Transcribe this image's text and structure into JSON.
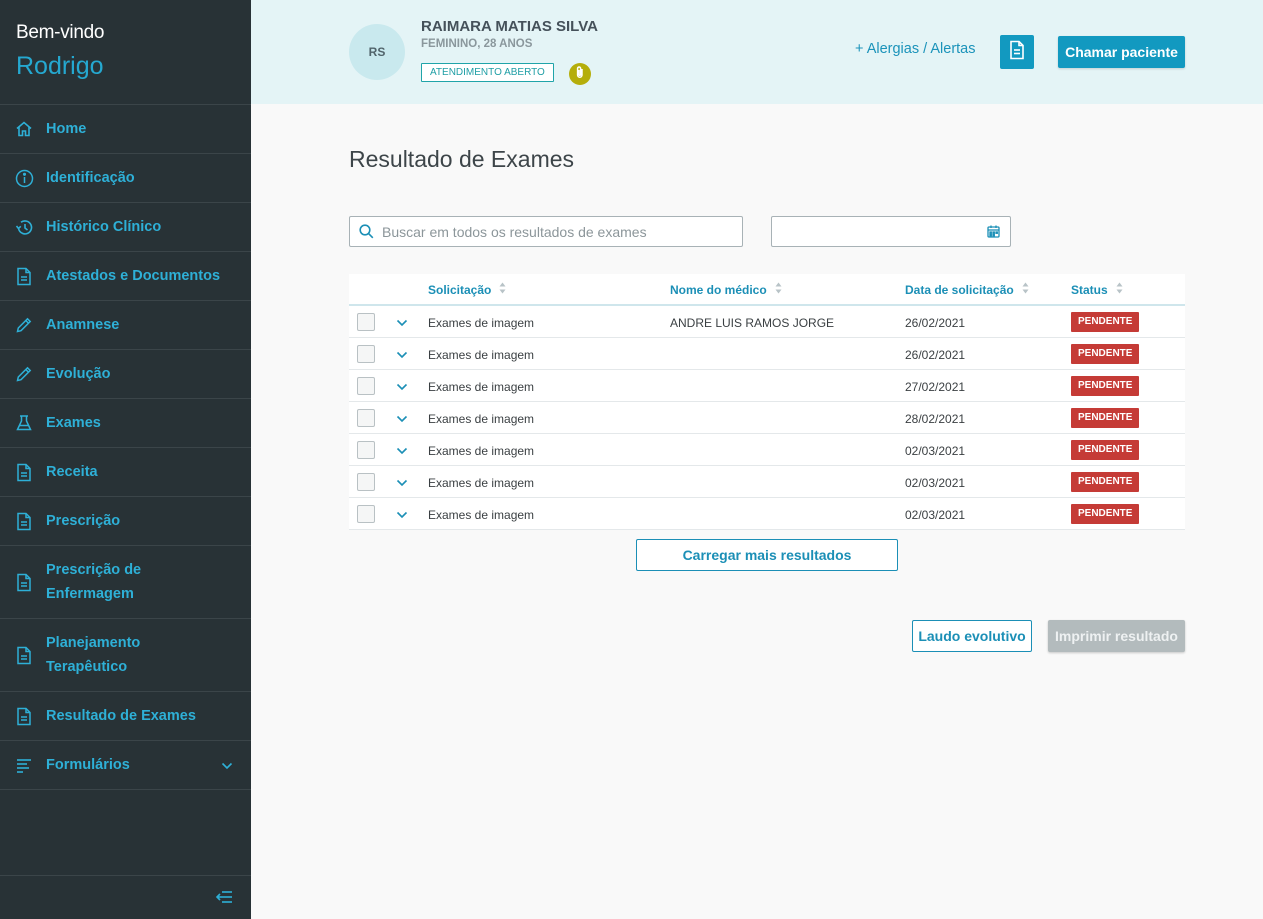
{
  "sidebar": {
    "welcome": "Bem-vindo",
    "user": "Rodrigo",
    "items": [
      {
        "label": "Home",
        "icon": "home-icon"
      },
      {
        "label": "Identificação",
        "icon": "info-icon"
      },
      {
        "label": "Histórico Clínico",
        "icon": "history-icon"
      },
      {
        "label": "Atestados e Documentos",
        "icon": "document-icon"
      },
      {
        "label": "Anamnese",
        "icon": "pencil-icon"
      },
      {
        "label": "Evolução",
        "icon": "pencil-icon"
      },
      {
        "label": "Exames",
        "icon": "flask-icon"
      },
      {
        "label": "Receita",
        "icon": "document-icon"
      },
      {
        "label": "Prescrição",
        "icon": "document-icon"
      },
      {
        "label_line1": "Prescrição de",
        "label_line2": "Enfermagem",
        "icon": "document-icon"
      },
      {
        "label_line1": "Planejamento",
        "label_line2": "Terapêutico",
        "icon": "document-icon"
      },
      {
        "label": "Resultado de Exames",
        "icon": "document-icon"
      },
      {
        "label": "Formulários",
        "icon": "list-icon"
      }
    ]
  },
  "header": {
    "avatar_initials": "RS",
    "patient_name": "RAIMARA MATIAS SILVA",
    "patient_info": "FEMININO, 28 ANOS",
    "status_badge": "ATENDIMENTO ABERTO",
    "alerts_link": "+ Alergias / Alertas",
    "call_button": "Chamar paciente"
  },
  "main": {
    "title": "Resultado de Exames",
    "search_placeholder": "Buscar em todos os resultados de exames",
    "date_value": "",
    "columns": [
      "Solicitação",
      "Nome do médico",
      "Data de solicitação",
      "Status"
    ],
    "rows": [
      {
        "solicitacao": "Exames de imagem",
        "medico": "ANDRE LUIS RAMOS JORGE",
        "data": "26/02/2021",
        "status": "PENDENTE"
      },
      {
        "solicitacao": "Exames de imagem",
        "medico": "",
        "data": "26/02/2021",
        "status": "PENDENTE"
      },
      {
        "solicitacao": "Exames de imagem",
        "medico": "",
        "data": "27/02/2021",
        "status": "PENDENTE"
      },
      {
        "solicitacao": "Exames de imagem",
        "medico": "",
        "data": "28/02/2021",
        "status": "PENDENTE"
      },
      {
        "solicitacao": "Exames de imagem",
        "medico": "",
        "data": "02/03/2021",
        "status": "PENDENTE"
      },
      {
        "solicitacao": "Exames de imagem",
        "medico": "",
        "data": "02/03/2021",
        "status": "PENDENTE"
      },
      {
        "solicitacao": "Exames de imagem",
        "medico": "",
        "data": "02/03/2021",
        "status": "PENDENTE"
      }
    ],
    "load_more": "Carregar mais resultados",
    "laudo_button": "Laudo evolutivo",
    "print_button": "Imprimir resultado"
  },
  "colors": {
    "sidebar_bg": "#283236",
    "accent": "#1299c0",
    "header_bg": "#e4f4f6",
    "status_pending": "#c53b36"
  }
}
